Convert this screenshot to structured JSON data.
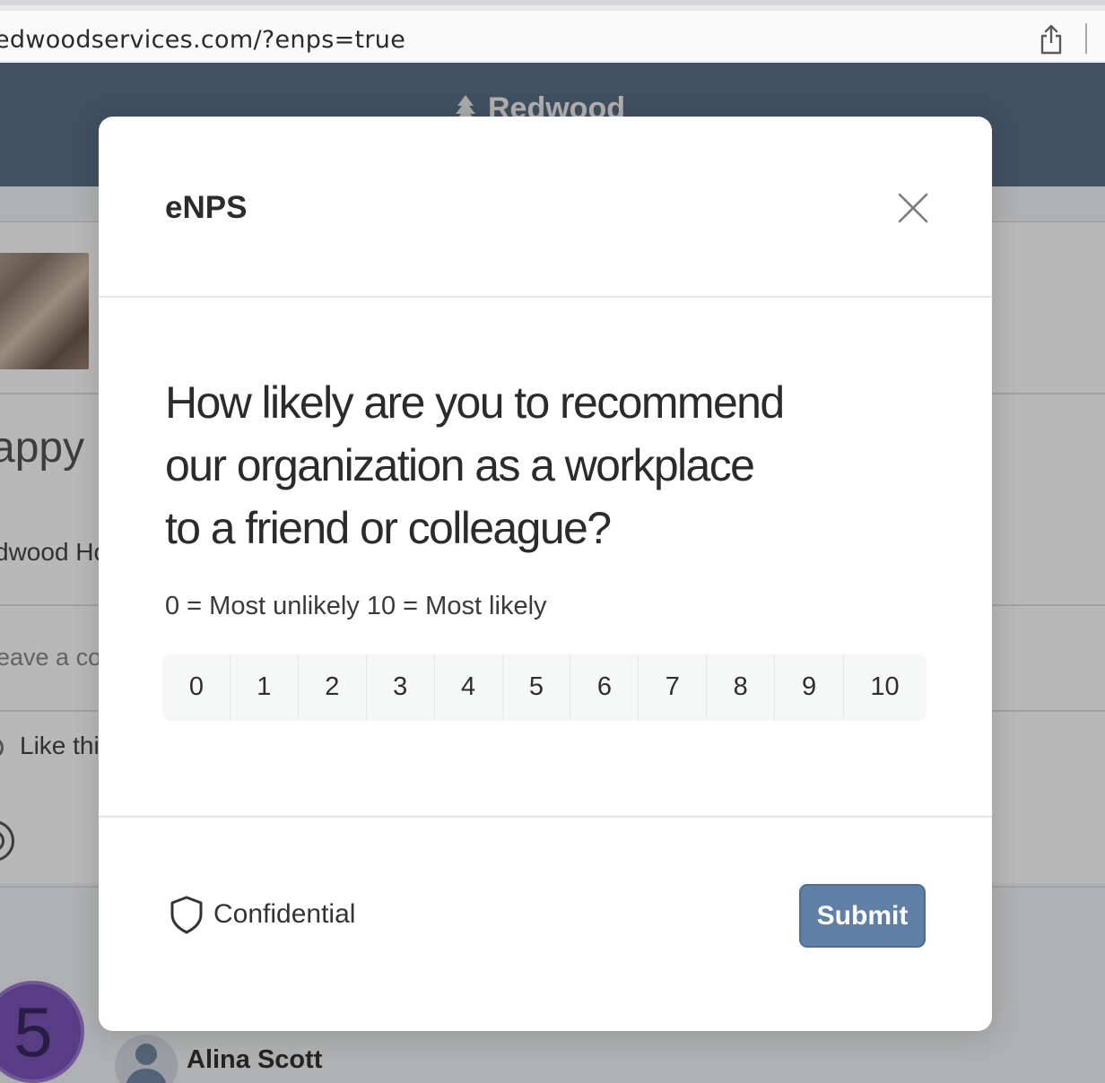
{
  "browser": {
    "url": "edwoodservices.com/?enps=true",
    "share_icon": "share-icon"
  },
  "background": {
    "brand_name": "Redwood",
    "headline_fragment": "appy",
    "author_fragment": "dwood Ho",
    "comment_placeholder_fragment": "eave a co",
    "like_fragment": "Like thi",
    "score_badge": "5",
    "commenter_name": "Alina Scott"
  },
  "modal": {
    "title": "eNPS",
    "close_icon": "close-icon",
    "question": "How likely are you to recommend our organization as a workplace to a friend or colleague?",
    "question_lines": [
      "How likely are you to recommend",
      "our organization as a workplace",
      "to a friend or colleague?"
    ],
    "scale_hint": "0 = Most unlikely 10 = Most likely",
    "scale_options": [
      "0",
      "1",
      "2",
      "3",
      "4",
      "5",
      "6",
      "7",
      "8",
      "9",
      "10"
    ],
    "confidential_icon": "shield-icon",
    "confidential_label": "Confidential",
    "submit_label": "Submit",
    "colors": {
      "submit_bg": "#5f7fa5",
      "header_bg": "#5a6f86",
      "badge_bg": "#7a54b8"
    }
  }
}
